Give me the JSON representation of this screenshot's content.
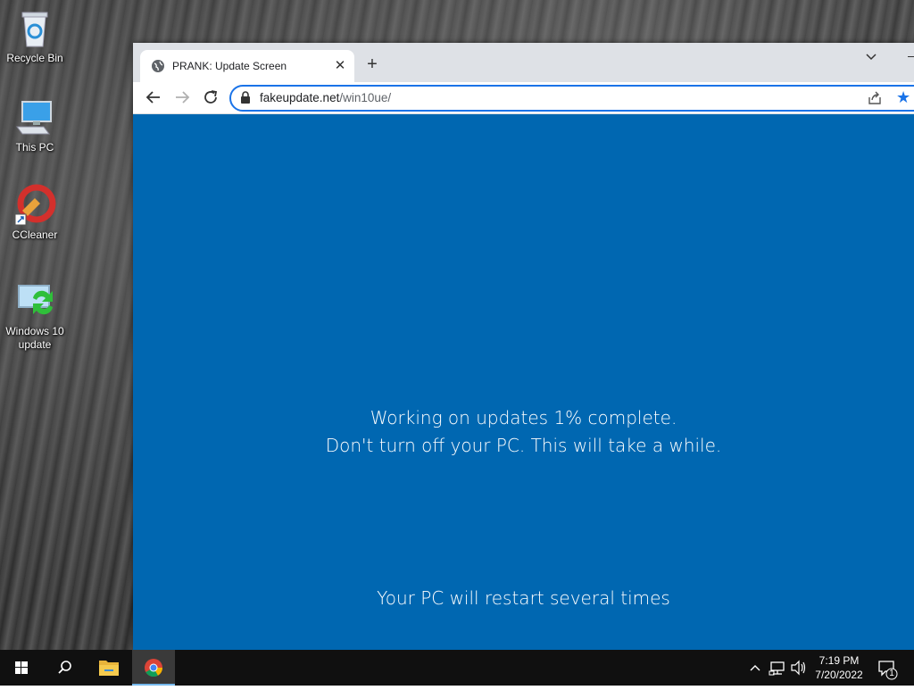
{
  "desktop": {
    "icons": [
      {
        "label": "Recycle Bin"
      },
      {
        "label": "This PC"
      },
      {
        "label": "CCleaner"
      },
      {
        "label": "Windows 10 update"
      }
    ]
  },
  "browser": {
    "tab": {
      "title": "PRANK: Update Screen"
    },
    "omnibox": {
      "url_host": "fakeupdate.net",
      "url_path": "/win10ue/"
    }
  },
  "page": {
    "line1": "Working on updates  1% complete.",
    "line2": "Don't turn off your PC. This will take a while.",
    "footer": "Your PC will restart several times",
    "background_color": "#0067b1"
  },
  "taskbar": {
    "time": "7:19 PM",
    "date": "7/20/2022",
    "notification_count": "1",
    "pinned": [
      "start-icon",
      "search-icon",
      "file-explorer-icon",
      "chrome-icon"
    ]
  }
}
